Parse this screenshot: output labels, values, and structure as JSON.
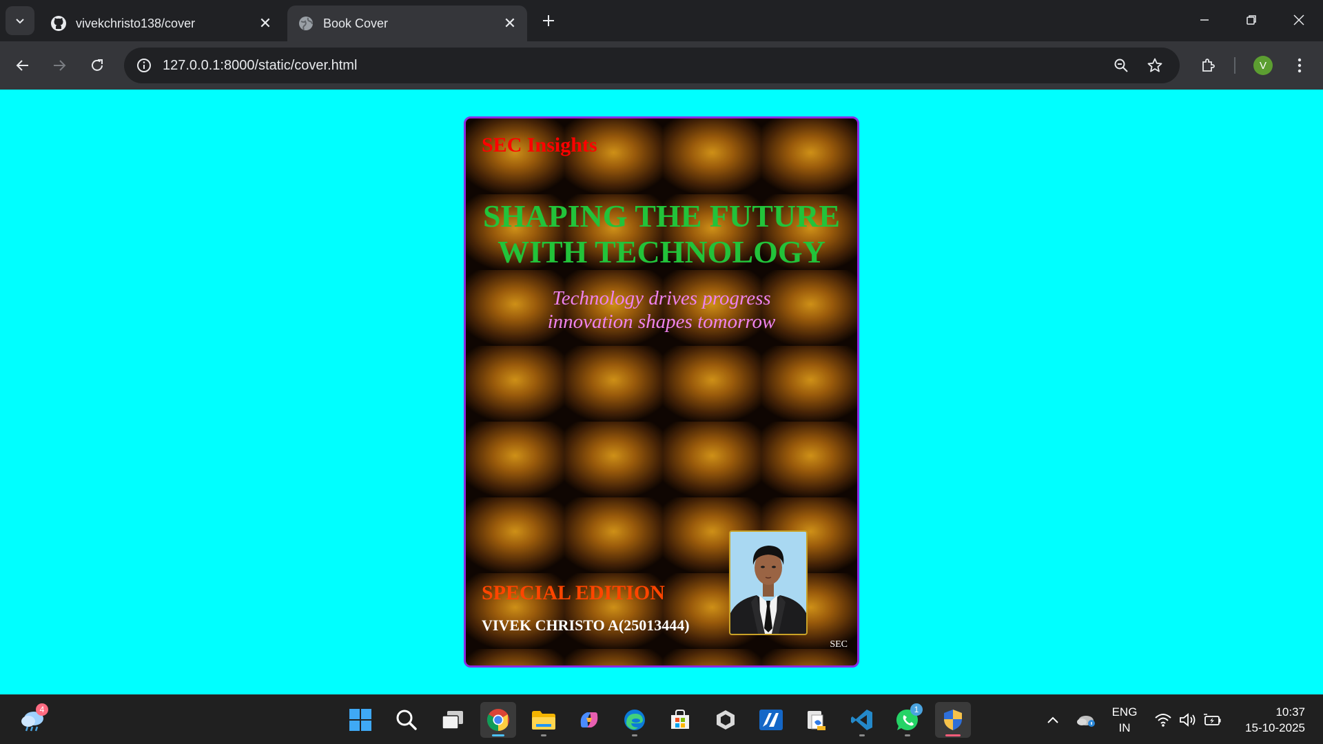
{
  "browser": {
    "tabs": [
      {
        "title": "vivekchristo138/cover",
        "favicon": "github-icon",
        "active": false
      },
      {
        "title": "Book Cover",
        "favicon": "globe-icon",
        "active": true
      }
    ],
    "url": {
      "host": "127.0.0.1",
      "rest": ":8000/static/cover.html"
    },
    "profile_initial": "V"
  },
  "page": {
    "background_color": "#00ffff",
    "cover": {
      "imprint": "SEC Insights",
      "headline_line1": "SHAPING THE FUTURE",
      "headline_line2": "WITH TECHNOLOGY",
      "tagline_line1": "Technology drives progress",
      "tagline_line2": "innovation shapes tomorrow",
      "edition": "SPECIAL EDITION",
      "author": "VIVEK CHRISTO A(25013444)",
      "mark": "SEC",
      "colors": {
        "border": "#8a2be2",
        "imprint": "#ff0000",
        "headline": "#22c33a",
        "tagline": "#ee82ee",
        "edition": "#ff4500",
        "author": "#ffffff"
      }
    }
  },
  "taskbar": {
    "weather_badge": "4",
    "whatsapp_badge": "1",
    "apps": [
      "start-icon",
      "search-icon",
      "task-view-icon",
      "chrome-icon",
      "file-explorer-icon",
      "copilot-icon",
      "edge-icon",
      "store-icon",
      "unity-icon",
      "azure-icon",
      "files-icon",
      "vscode-icon",
      "whatsapp-icon",
      "security-shield-icon"
    ],
    "language": {
      "line1": "ENG",
      "line2": "IN"
    },
    "clock": {
      "time": "10:37",
      "date": "15-10-2025"
    }
  }
}
